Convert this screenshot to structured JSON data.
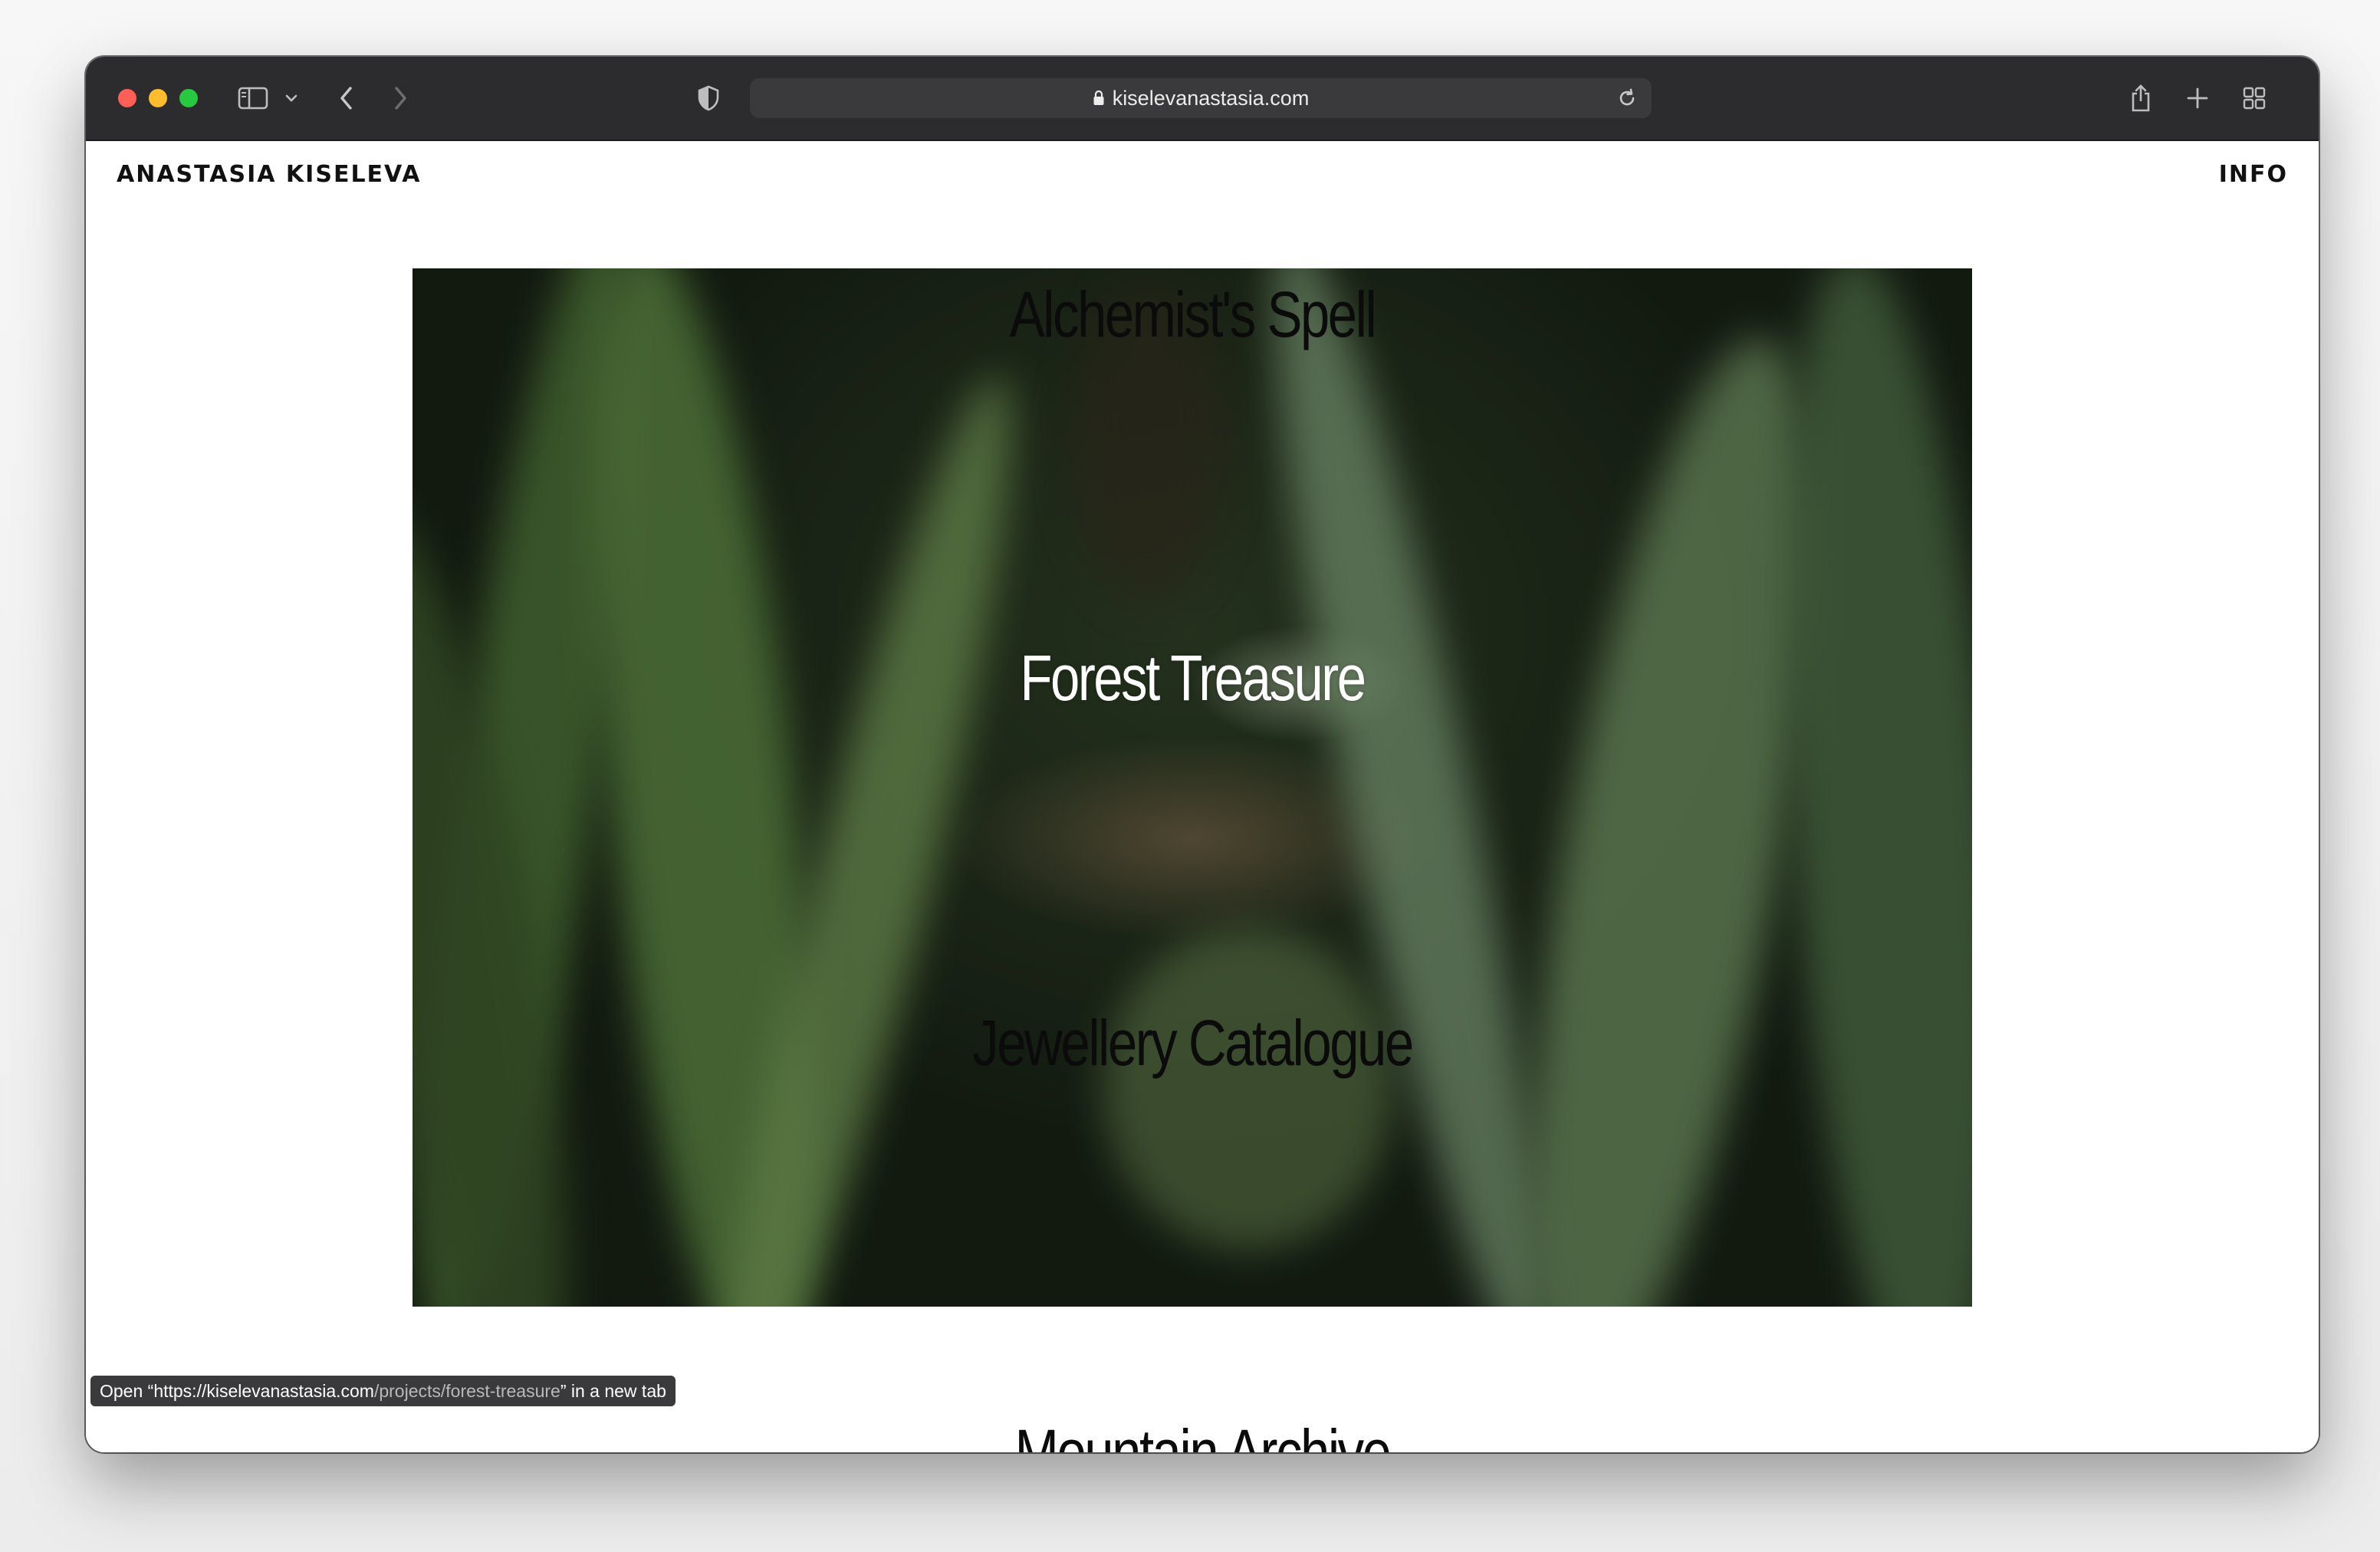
{
  "browser": {
    "url": "kiselevanastasia.com",
    "status_prefix": "Open “https://kiselevanastasia.com",
    "status_path": "/projects/forest-treasure",
    "status_suffix": "” in a new tab"
  },
  "site": {
    "name": "ANASTASIA KISELEVA",
    "info": "INFO"
  },
  "projects": [
    "Alchemist's Spell",
    "Forest Treasure",
    "Jewellery Catalogue",
    "Mountain Archive"
  ],
  "colors": {
    "toolbar": "#2c2c2e",
    "address_bar": "#3a3a3c",
    "close": "#ff5f57",
    "minimize": "#febc2e",
    "zoom": "#28c840"
  }
}
